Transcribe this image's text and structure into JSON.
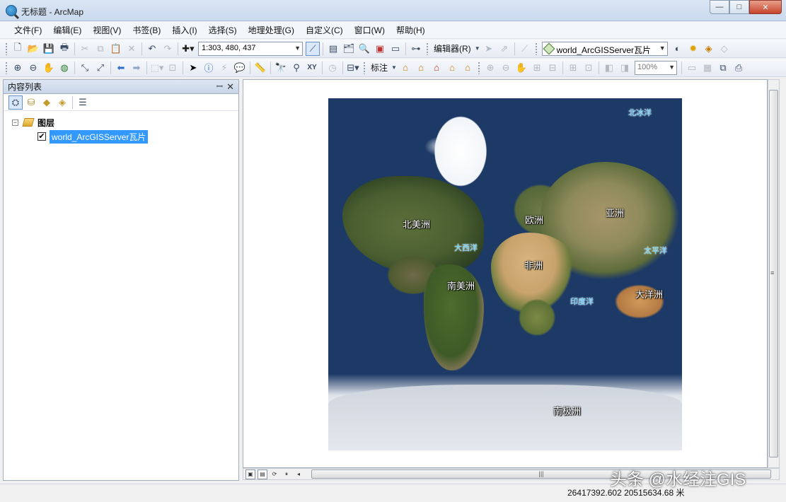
{
  "window": {
    "title": "无标题 - ArcMap",
    "controls": [
      "—",
      "□",
      "✕"
    ]
  },
  "menu": [
    "文件(F)",
    "编辑(E)",
    "视图(V)",
    "书签(B)",
    "插入(I)",
    "选择(S)",
    "地理处理(G)",
    "自定义(C)",
    "窗口(W)",
    "帮助(H)"
  ],
  "toolbar1": {
    "scale": "1:303, 480, 437",
    "editor_label": "编辑器(R)",
    "active_layer": "world_ArcGISServer瓦片"
  },
  "toolbar2": {
    "label_menu": "标注",
    "zoom": "100%"
  },
  "toc": {
    "title": "内容列表",
    "group": "图层",
    "layer": "world_ArcGISServer瓦片",
    "checked": "✔"
  },
  "map": {
    "labels": {
      "north_america": "北美洲",
      "europe": "欧洲",
      "asia": "亚洲",
      "africa": "非洲",
      "south_america": "南美洲",
      "oceania": "大洋洲",
      "antarctica": "南极洲"
    },
    "oceans": {
      "arctic": "北冰洋",
      "atlantic": "大西洋",
      "pacific": "太平洋",
      "indian": "印度洋"
    }
  },
  "status": {
    "coordinates": "26417392.602 20515634.68 米"
  },
  "watermark": "头条 @水经注GIS"
}
